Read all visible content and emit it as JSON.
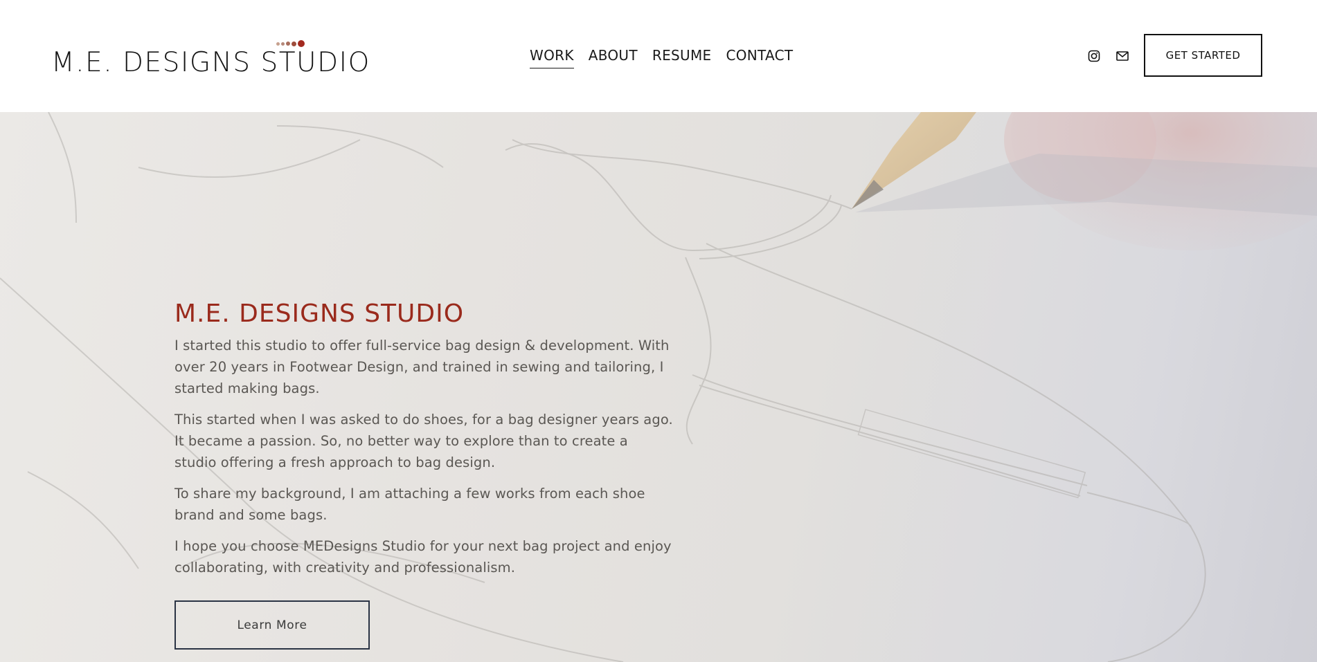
{
  "header": {
    "logo": {
      "text": "M.E. DESIGNS STUDIO",
      "dot_colors": [
        "#c7a18e",
        "#b5897a",
        "#a86e5c",
        "#9e4c3b",
        "#a32a1f"
      ]
    },
    "nav": [
      {
        "label": "WORK",
        "active": true
      },
      {
        "label": "ABOUT",
        "active": false
      },
      {
        "label": "RESUME",
        "active": false
      },
      {
        "label": "CONTACT",
        "active": false
      }
    ],
    "social": [
      {
        "icon": "instagram-icon"
      },
      {
        "icon": "mail-icon"
      }
    ],
    "cta_label": "GET STARTED"
  },
  "hero": {
    "title": "M.E. DESIGNS STUDIO",
    "paragraphs": [
      "I started this studio to offer full-service bag design & development. With over 20 years in Footwear Design, and trained in sewing and tailoring, I started making bags.",
      "This started when I was asked to do shoes, for a bag designer years ago. It became a passion. So, no better way to explore than to create a studio offering a fresh approach to bag design.",
      "To share my background, I am attaching a few works from each shoe brand and some bags.",
      "I hope you choose MEDesigns Studio for your next bag project and enjoy collaborating, with creativity and professionalism."
    ],
    "button_label": "Learn More"
  },
  "colors": {
    "accent": "#9a2a1c",
    "text": "#5a5753",
    "button_border": "#2a3344"
  }
}
